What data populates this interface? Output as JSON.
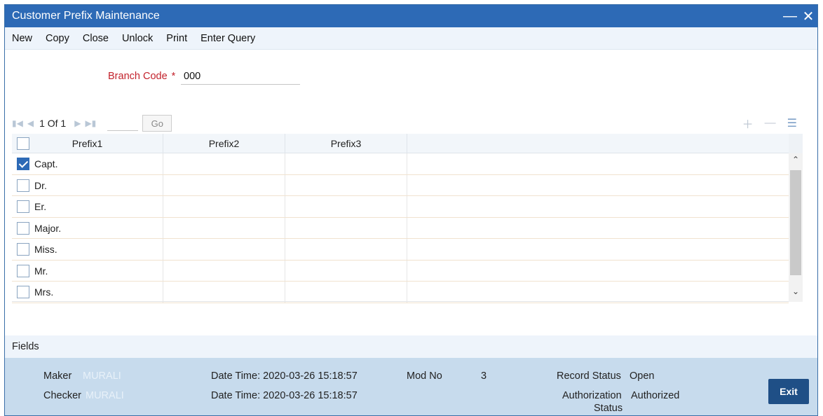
{
  "window": {
    "title": "Customer Prefix Maintenance",
    "minimize_icon": "minimize-icon",
    "close_icon": "close-icon"
  },
  "toolbar": {
    "items": [
      "New",
      "Copy",
      "Close",
      "Unlock",
      "Print",
      "Enter Query"
    ]
  },
  "branch": {
    "label": "Branch Code",
    "required_mark": "*",
    "value": "000"
  },
  "pager": {
    "page_text": "1 Of 1",
    "go_label": "Go"
  },
  "grid": {
    "headers": [
      "Prefix1",
      "Prefix2",
      "Prefix3"
    ],
    "rows": [
      {
        "checked": true,
        "prefix1": "Capt.",
        "prefix2": "",
        "prefix3": ""
      },
      {
        "checked": false,
        "prefix1": "Dr.",
        "prefix2": "",
        "prefix3": ""
      },
      {
        "checked": false,
        "prefix1": "Er.",
        "prefix2": "",
        "prefix3": ""
      },
      {
        "checked": false,
        "prefix1": "Major.",
        "prefix2": "",
        "prefix3": ""
      },
      {
        "checked": false,
        "prefix1": "Miss.",
        "prefix2": "",
        "prefix3": ""
      },
      {
        "checked": false,
        "prefix1": "Mr.",
        "prefix2": "",
        "prefix3": ""
      },
      {
        "checked": false,
        "prefix1": "Mrs.",
        "prefix2": "",
        "prefix3": ""
      }
    ]
  },
  "fields_label": "Fields",
  "audit": {
    "maker_label": "Maker",
    "maker_value": "MURALI",
    "checker_label": "Checker",
    "checker_value": "MURALI",
    "maker_datetime": "Date Time: 2020-03-26 15:18:57",
    "checker_datetime": "Date Time: 2020-03-26 15:18:57",
    "mod_no_label": "Mod No",
    "mod_no_value": "3",
    "record_status_label": "Record Status",
    "record_status_value": "Open",
    "auth_status_label_1": "Authorization",
    "auth_status_label_2": "Status",
    "auth_status_value": "Authorized"
  },
  "exit_label": "Exit",
  "colors": {
    "titlebar": "#2d6ab6",
    "footer": "#c7dbed",
    "exit_button": "#1f4f86",
    "required": "#c3222c"
  }
}
